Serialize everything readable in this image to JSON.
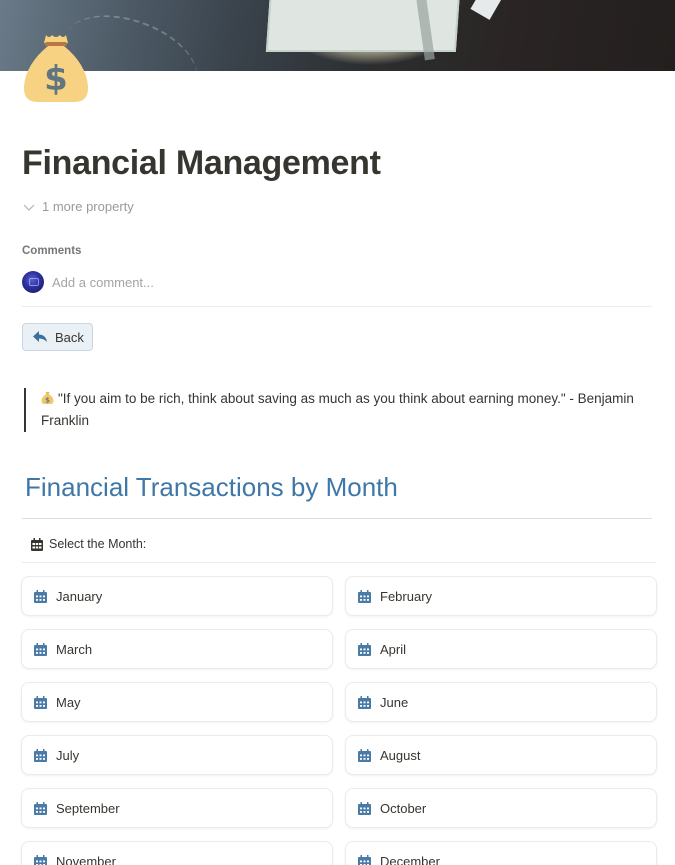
{
  "page": {
    "cover_image": "money-cover",
    "icon": "money-bag-icon",
    "title": "Financial Management",
    "more_properties": "1 more property"
  },
  "comments": {
    "label": "Comments",
    "placeholder": "Add a comment..."
  },
  "back_button": {
    "label": "Back",
    "icon": "reply-arrow-icon"
  },
  "quote": {
    "icon": "money-bag-emoji",
    "text": "\"If you aim to be rich, think about saving as much as you think about earning money.\" - Benjamin Franklin"
  },
  "section": {
    "title": "Financial Transactions by Month",
    "select_label": "Select the Month:",
    "select_icon": "calendar-icon"
  },
  "months": [
    {
      "label": "January"
    },
    {
      "label": "February"
    },
    {
      "label": "March"
    },
    {
      "label": "April"
    },
    {
      "label": "May"
    },
    {
      "label": "June"
    },
    {
      "label": "July"
    },
    {
      "label": "August"
    },
    {
      "label": "September"
    },
    {
      "label": "October"
    },
    {
      "label": "November"
    },
    {
      "label": "December"
    }
  ],
  "colors": {
    "accent": "#3f78a8",
    "calendar_icon": "#4a7ba6",
    "back_button_bg": "#eaf1f6",
    "text": "#37352f"
  }
}
